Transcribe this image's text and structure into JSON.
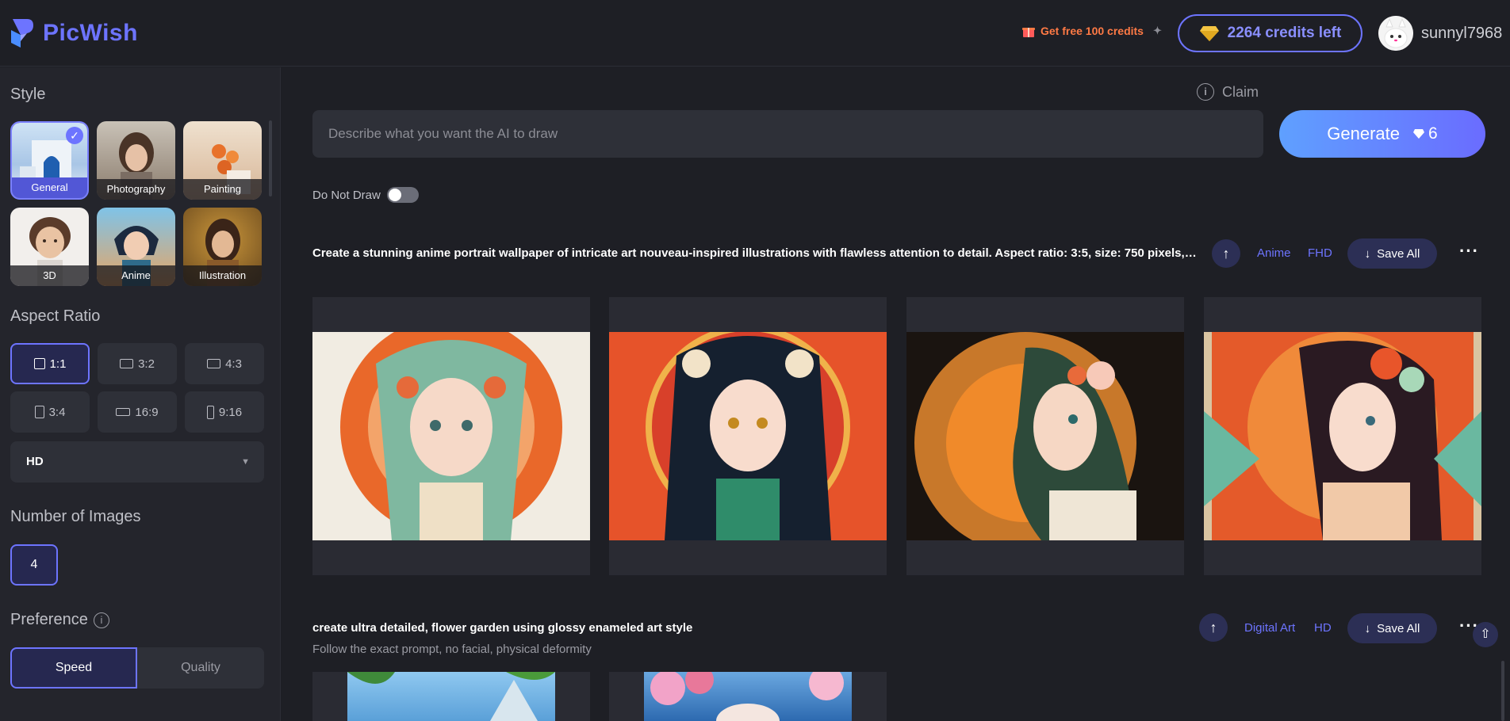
{
  "app": {
    "name": "PicWish",
    "brand_color": "#6d74ff"
  },
  "header": {
    "free_credits": "Get free 100 credits",
    "credits": "2264 credits left",
    "username": "sunnyl7968"
  },
  "sidebar": {
    "style_title": "Style",
    "styles": [
      {
        "label": "General",
        "selected": true
      },
      {
        "label": "Photography"
      },
      {
        "label": "Painting"
      },
      {
        "label": "3D"
      },
      {
        "label": "Anime"
      },
      {
        "label": "Illustration"
      }
    ],
    "aspect_title": "Aspect Ratio",
    "aspect_ratios": [
      {
        "label": "1:1",
        "selected": true
      },
      {
        "label": "3:2"
      },
      {
        "label": "4:3"
      },
      {
        "label": "3:4"
      },
      {
        "label": "16:9"
      },
      {
        "label": "9:16"
      }
    ],
    "quality_select": "HD",
    "number_title": "Number of Images",
    "number_value": "4",
    "preference_title": "Preference",
    "preference_options": [
      "Speed",
      "Quality"
    ],
    "preference_selected": "Speed"
  },
  "main": {
    "claim": "Claim",
    "prompt_placeholder": "Describe what you want the AI to draw",
    "generate_label": "Generate",
    "generate_cost": "6",
    "do_not_draw": "Do Not Draw",
    "do_not_draw_on": false,
    "tasks": [
      {
        "prompt": "Create a stunning anime portrait wallpaper of intricate art nouveau-inspired illustrations with flawless attention to detail. Aspect ratio: 3:5, size: 750 pixels, with ...",
        "style_tag": "Anime",
        "quality_tag": "FHD",
        "save_all": "Save All"
      },
      {
        "prompt": "create ultra detailed, flower garden using glossy enameled art style",
        "negative": "Follow the exact prompt, no facial, physical deformity",
        "style_tag": "Digital Art",
        "quality_tag": "HD",
        "save_all": "Save All"
      }
    ]
  }
}
